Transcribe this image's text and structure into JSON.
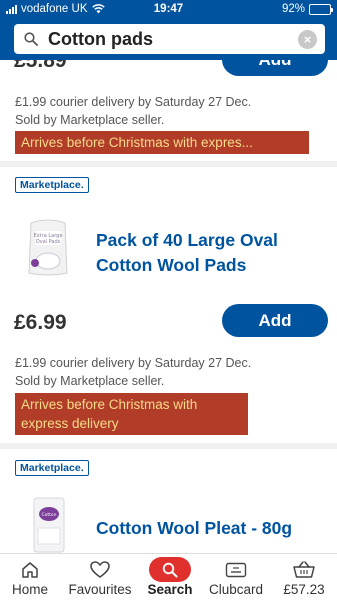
{
  "status_bar": {
    "carrier": "vodafone UK",
    "time": "19:47",
    "battery": "92%"
  },
  "search": {
    "query": "Cotton pads",
    "clear_icon": "close-icon"
  },
  "products": [
    {
      "price": "£5.89",
      "add_label": "Add",
      "delivery_line": "£1.99 courier delivery by Saturday 27 Dec.",
      "seller_line": "Sold by Marketplace seller.",
      "banner": "Arrives before Christmas with expres..."
    },
    {
      "badge": "Marketplace.",
      "title_line1": "Pack of 40 Large Oval",
      "title_line2": "Cotton Wool Pads",
      "price": "£6.99",
      "add_label": "Add",
      "delivery_line": "£1.99 courier delivery by Saturday 27 Dec.",
      "seller_line": "Sold by Marketplace seller.",
      "banner_line1": "Arrives before Christmas with",
      "banner_line2": "express delivery"
    },
    {
      "badge": "Marketplace.",
      "title": "Cotton Wool Pleat - 80g"
    }
  ],
  "nav": {
    "items": [
      {
        "label": "Home",
        "icon": "home-icon"
      },
      {
        "label": "Favourites",
        "icon": "heart-icon"
      },
      {
        "label": "Search",
        "icon": "search-icon",
        "active": true
      },
      {
        "label": "Clubcard",
        "icon": "clubcard-icon"
      },
      {
        "label": "£57.23",
        "icon": "basket-icon"
      }
    ]
  },
  "colors": {
    "brand_blue": "#00539f",
    "banner_red": "#b13c28",
    "banner_text": "#f7dc8b",
    "search_active": "#e0302e"
  }
}
